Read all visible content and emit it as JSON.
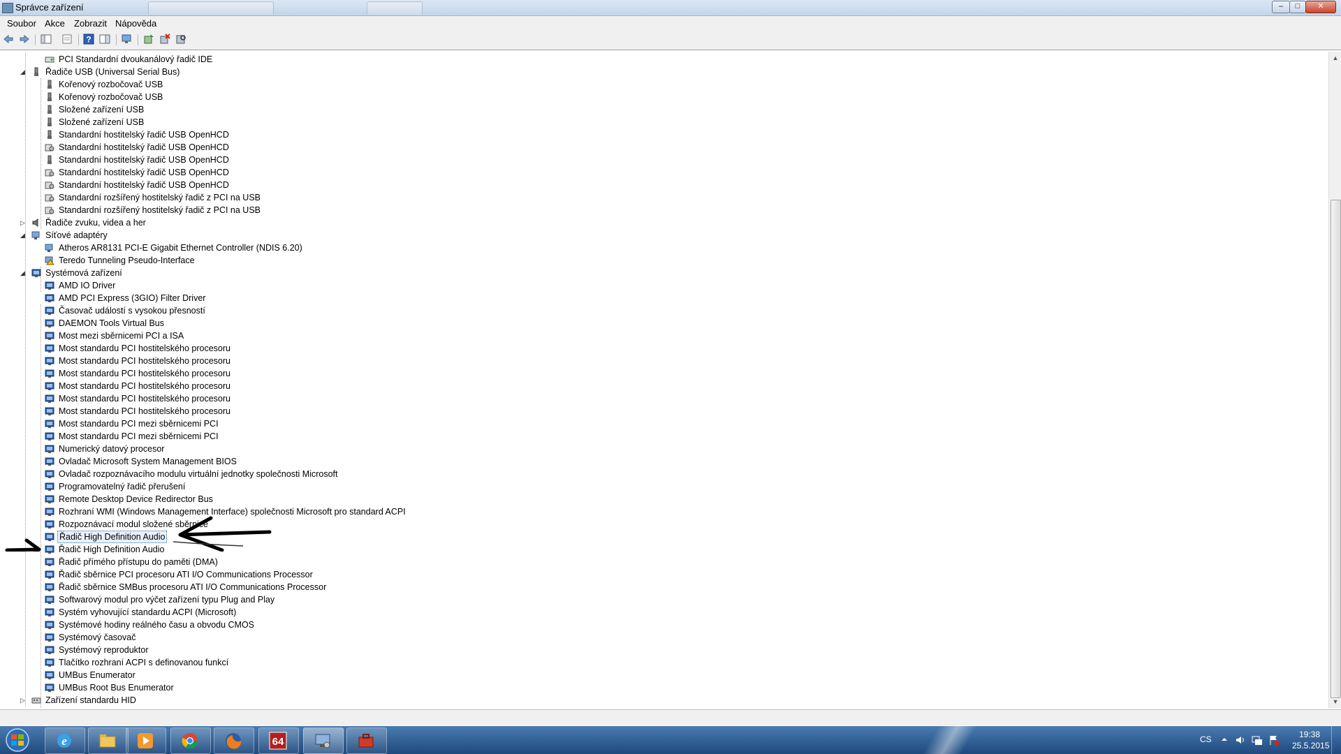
{
  "window": {
    "title": "Správce zařízení",
    "controls": {
      "minimize": "–",
      "maximize": "□",
      "close": "✕"
    }
  },
  "menu": [
    "Soubor",
    "Akce",
    "Zobrazit",
    "Nápověda"
  ],
  "toolbar_icons": [
    "back-arrow-icon",
    "forward-arrow-icon",
    "show-hide-tree-icon",
    "properties-icon",
    "help-icon",
    "action-pane-icon",
    "monitor-icon",
    "update-driver-icon",
    "uninstall-icon",
    "scan-hardware-icon"
  ],
  "tree": {
    "top_item": "PCI Standardní dvoukanálový řadič IDE",
    "usb": {
      "label": "Řadiče USB (Universal Serial Bus)",
      "children": [
        "Kořenový rozbočovač USB",
        "Kořenový rozbočovač USB",
        "Složené zařízení USB",
        "Složené zařízení USB",
        "Standardní hostitelský řadič  USB OpenHCD",
        "Standardní hostitelský řadič  USB OpenHCD",
        "Standardní hostitelský řadič  USB OpenHCD",
        "Standardní hostitelský řadič  USB OpenHCD",
        "Standardní hostitelský řadič  USB OpenHCD",
        "Standardní rozšířený hostitelský řadič z PCI na USB",
        "Standardní rozšířený hostitelský řadič z PCI na USB"
      ]
    },
    "sound": {
      "label": "Řadiče zvuku, videa a her"
    },
    "network": {
      "label": "Síťové adaptéry",
      "children": [
        "Atheros AR8131 PCI-E Gigabit Ethernet Controller (NDIS 6.20)",
        "Teredo Tunneling Pseudo-Interface"
      ]
    },
    "system": {
      "label": "Systémová zařízení",
      "children": [
        "AMD IO Driver",
        "AMD PCI Express (3GIO) Filter Driver",
        "Časovač událostí s vysokou přesností",
        "DAEMON Tools Virtual Bus",
        "Most mezi sběrnicemi PCI a ISA",
        "Most standardu PCI hostitelského procesoru",
        "Most standardu PCI hostitelského procesoru",
        "Most standardu PCI hostitelského procesoru",
        "Most standardu PCI hostitelského procesoru",
        "Most standardu PCI hostitelského procesoru",
        "Most standardu PCI hostitelského procesoru",
        "Most standardu PCI mezi sběrnicemi PCI",
        "Most standardu PCI mezi sběrnicemi PCI",
        "Numerický datový procesor",
        "Ovladač Microsoft System Management BIOS",
        "Ovladač rozpoznávacího modulu virtuální jednotky společnosti Microsoft",
        "Programovatelný řadič přerušení",
        "Remote Desktop Device Redirector Bus",
        "Rozhraní WMI (Windows Management Interface) společnosti Microsoft pro standard ACPI",
        "Rozpoznávací modul složené sběrnice",
        "Řadič High Definition Audio",
        "Řadič High Definition Audio",
        "Řadič přímého přístupu do paměti (DMA)",
        "Řadič sběrnice PCI procesoru ATI I/O Communications Processor",
        "Řadič sběrnice SMBus procesoru ATI I/O Communications Processor",
        "Softwarový modul pro výčet zařízení typu Plug and Play",
        "Systém vyhovující standardu ACPI (Microsoft)",
        "Systémové hodiny reálného času a obvodu CMOS",
        "Systémový časovač",
        "Systémový reproduktor",
        "Tlačítko rozhraní ACPI s definovanou funkcí",
        "UMBus Enumerator",
        "UMBus Root Bus Enumerator"
      ]
    },
    "hid": {
      "label": "Zařízení standardu HID"
    }
  },
  "taskbar": {
    "apps": [
      "ie-icon",
      "explorer-folder-icon",
      "media-player-icon",
      "chrome-icon",
      "firefox-icon",
      "cpu-z-64-icon",
      "device-manager-icon",
      "toolbox-icon"
    ],
    "language": "CS",
    "time": "19:38",
    "date": "25.5.2015"
  },
  "colors": {
    "accent": "#3a6ea5",
    "taskbar": "#2a5a90"
  }
}
